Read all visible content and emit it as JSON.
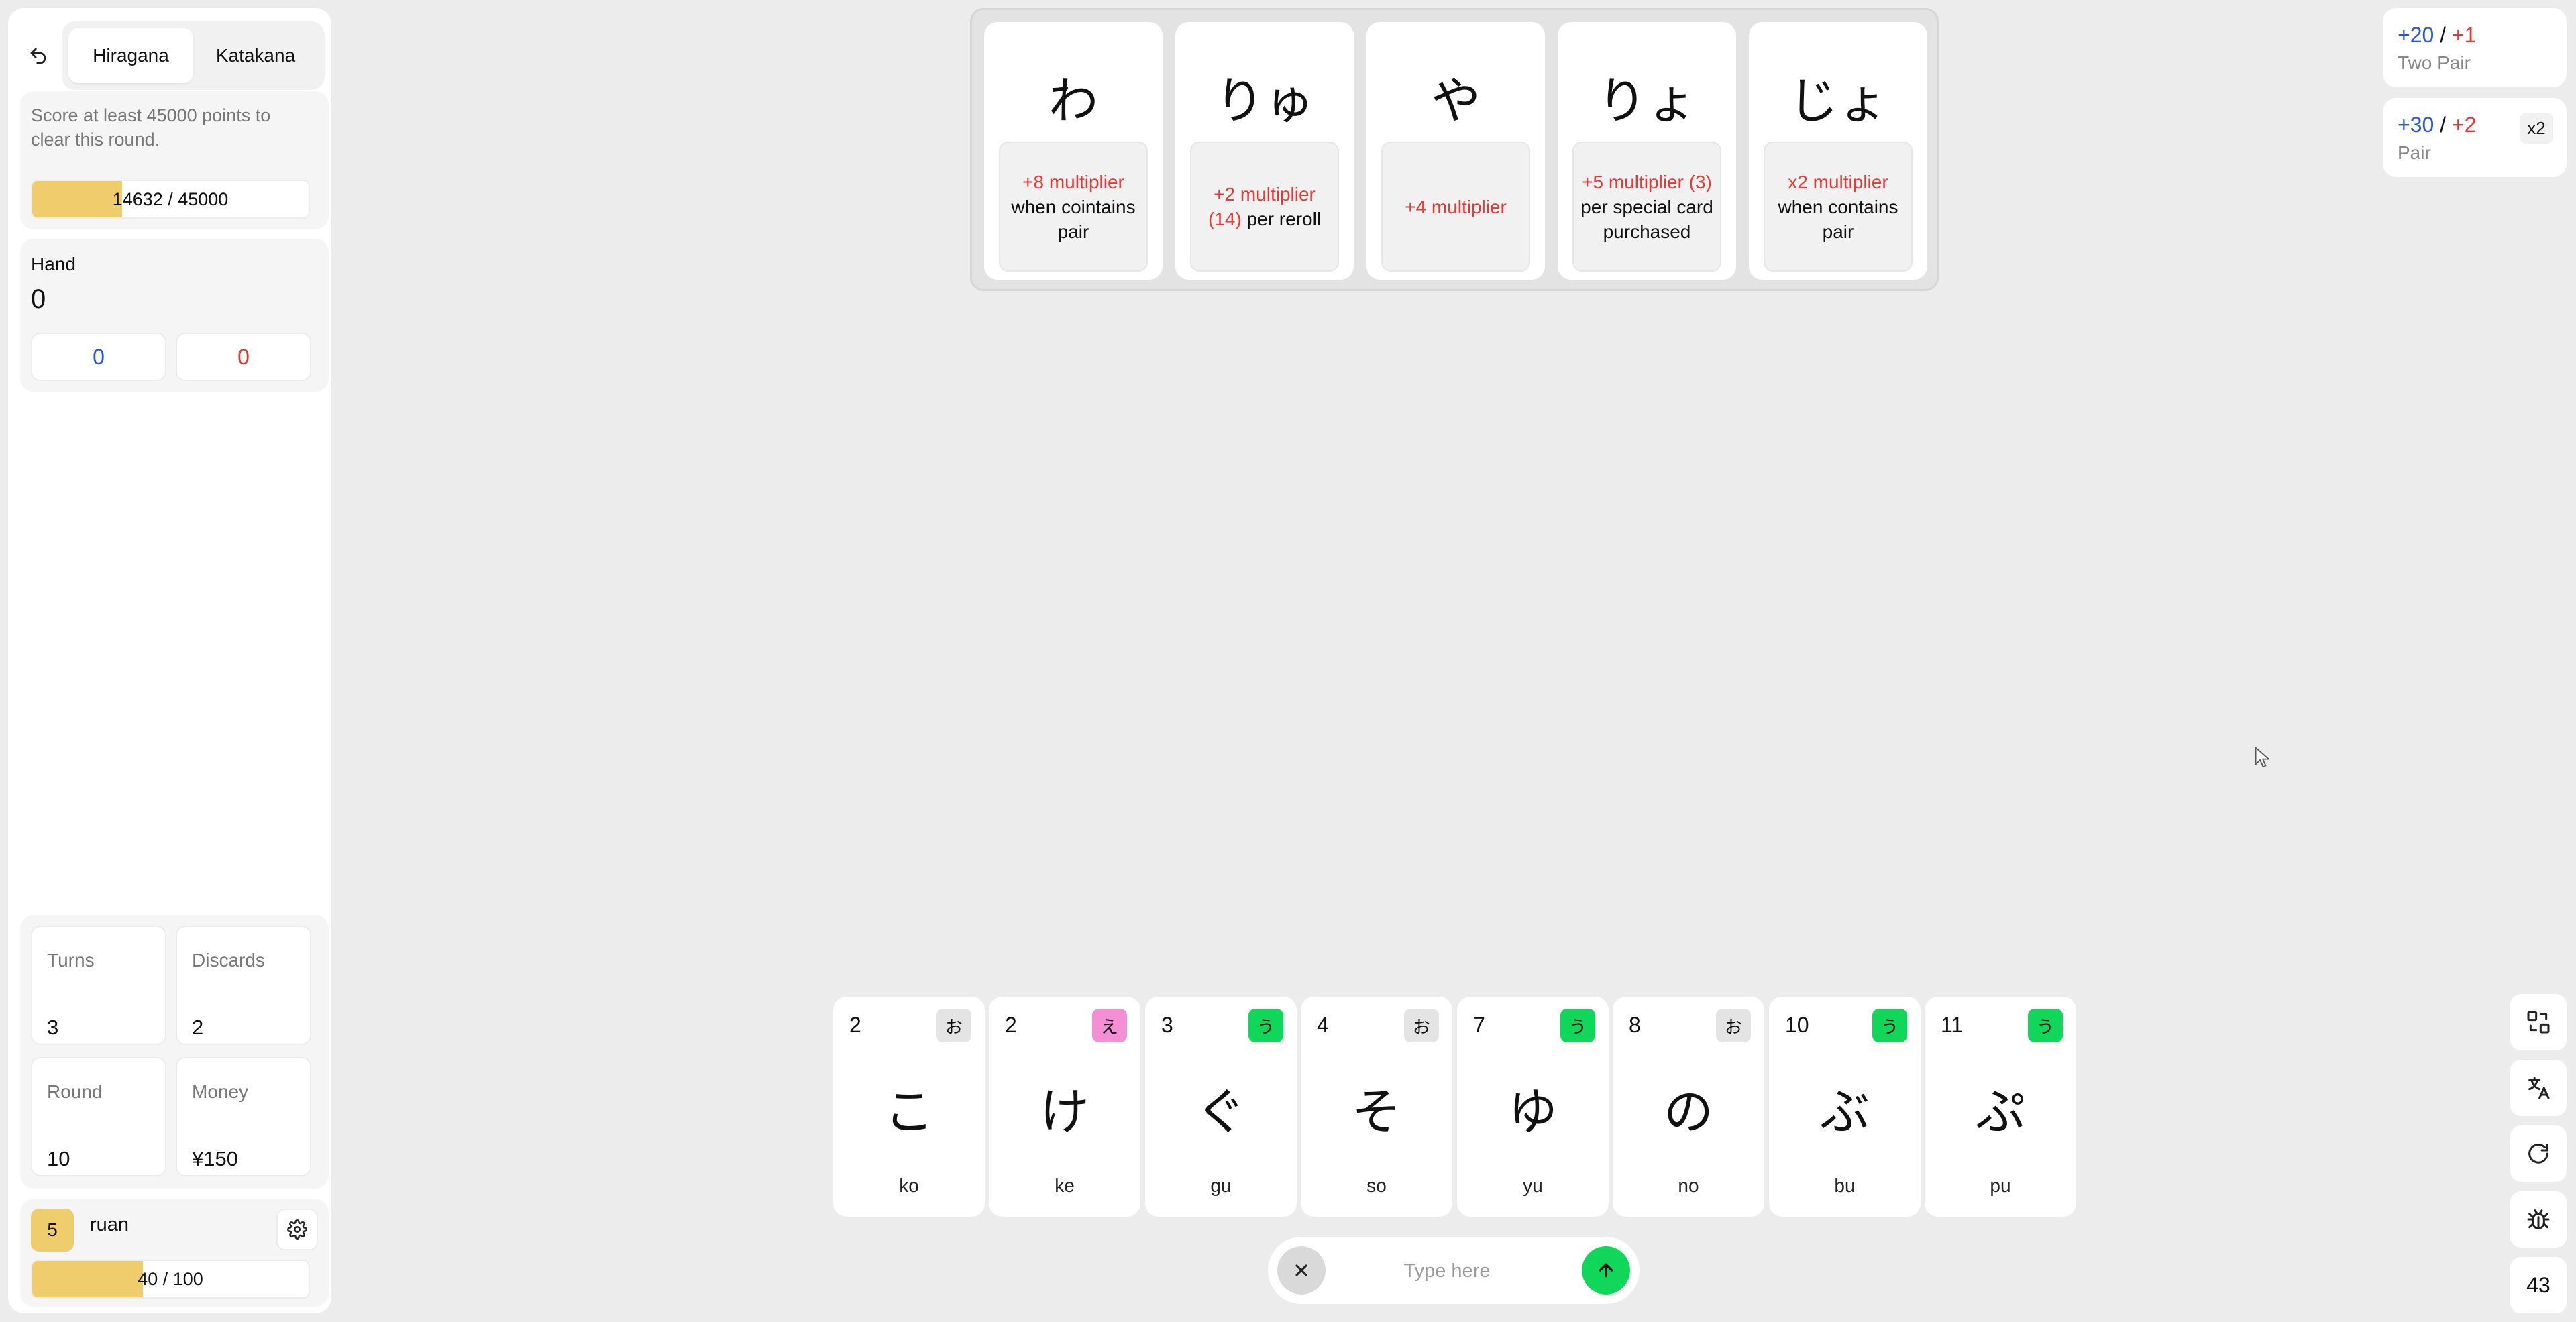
{
  "sidebar": {
    "tabs": [
      {
        "label": "Hiragana",
        "active": true
      },
      {
        "label": "Katakana",
        "active": false
      }
    ],
    "goal": {
      "text": "Score at least 45000 points to clear this round.",
      "score_text": "14632 / 45000",
      "progress": 0.325
    },
    "hand": {
      "label": "Hand",
      "value": "0",
      "chips": "0",
      "mult": "0"
    },
    "stats": {
      "turns": {
        "label": "Turns",
        "value": "3"
      },
      "discards": {
        "label": "Discards",
        "value": "2"
      },
      "round": {
        "label": "Round",
        "value": "10"
      },
      "money": {
        "label": "Money",
        "value": "¥150"
      }
    },
    "player": {
      "level": "5",
      "name": "ruan",
      "xp_text": "40 / 100",
      "xp_progress": 0.4
    }
  },
  "jokers": [
    {
      "kana": "わ",
      "desc": [
        {
          "t": "+8 multiplier",
          "c": "red"
        },
        {
          "t": " when cointains pair",
          "c": ""
        }
      ]
    },
    {
      "kana": "りゅ",
      "desc": [
        {
          "t": "+2 multiplier (14)",
          "c": "red"
        },
        {
          "t": " per reroll",
          "c": ""
        }
      ]
    },
    {
      "kana": "や",
      "desc": [
        {
          "t": "+4 multiplier",
          "c": "red"
        }
      ]
    },
    {
      "kana": "りょ",
      "desc": [
        {
          "t": "+5 multiplier (3)",
          "c": "red"
        },
        {
          "t": " per special card purchased",
          "c": ""
        }
      ]
    },
    {
      "kana": "じょ",
      "desc": [
        {
          "t": "x2 multiplier",
          "c": "red"
        },
        {
          "t": " when contains pair",
          "c": ""
        }
      ]
    }
  ],
  "hand_rules": [
    {
      "chips": "+20",
      "mult": "+1",
      "sep": "/",
      "name": "Two Pair",
      "level": ""
    },
    {
      "chips": "+30",
      "mult": "+2",
      "sep": "/",
      "name": "Pair",
      "level": "x2"
    }
  ],
  "cards": [
    {
      "value": "2",
      "badge": "お",
      "badge_color": "#e4e4e4",
      "kana": "こ",
      "romaji": "ko"
    },
    {
      "value": "2",
      "badge": "え",
      "badge_color": "#f48fd6",
      "kana": "け",
      "romaji": "ke"
    },
    {
      "value": "3",
      "badge": "う",
      "badge_color": "#10d659",
      "kana": "ぐ",
      "romaji": "gu"
    },
    {
      "value": "4",
      "badge": "お",
      "badge_color": "#e4e4e4",
      "kana": "そ",
      "romaji": "so"
    },
    {
      "value": "7",
      "badge": "う",
      "badge_color": "#10d659",
      "kana": "ゆ",
      "romaji": "yu"
    },
    {
      "value": "8",
      "badge": "お",
      "badge_color": "#e4e4e4",
      "kana": "の",
      "romaji": "no"
    },
    {
      "value": "10",
      "badge": "う",
      "badge_color": "#10d659",
      "kana": "ぶ",
      "romaji": "bu"
    },
    {
      "value": "11",
      "badge": "う",
      "badge_color": "#10d659",
      "kana": "ぷ",
      "romaji": "pu"
    }
  ],
  "input": {
    "placeholder": "Type here"
  },
  "tools": {
    "deck_count": "43",
    "icons": [
      "swap-icon",
      "translate-icon",
      "refresh-icon",
      "bug-icon"
    ]
  }
}
